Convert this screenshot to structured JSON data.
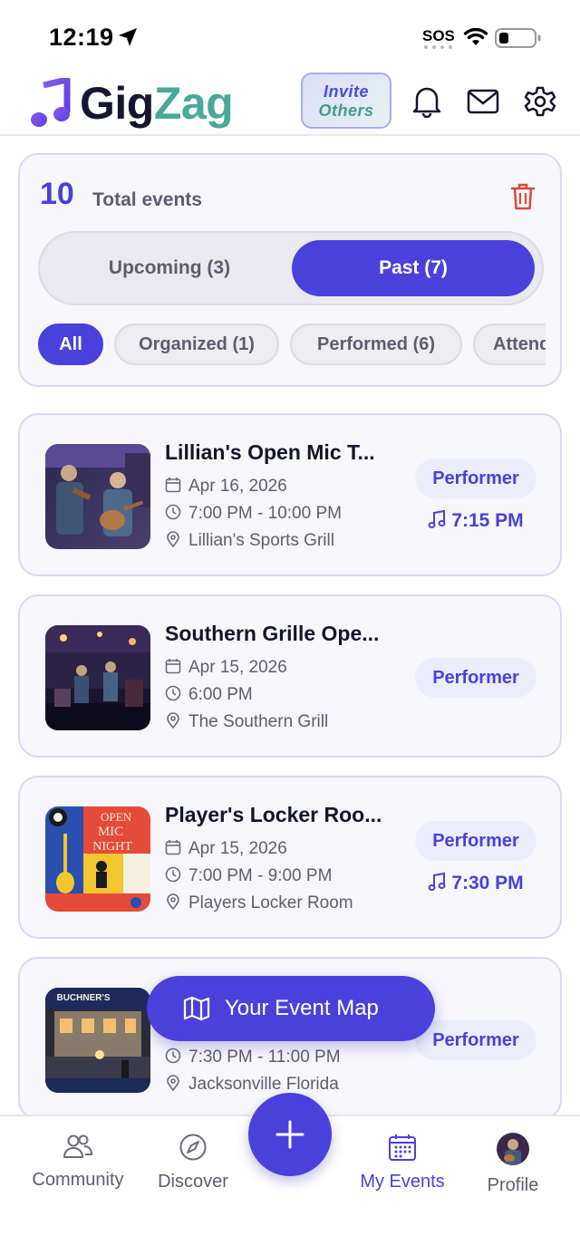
{
  "status_bar": {
    "time": "12:19",
    "sos": "SOS"
  },
  "header": {
    "logo_part1": "Gig",
    "logo_part2": "Zag",
    "invite_line1": "Invite",
    "invite_line2": "Others",
    "brand_color": "#4a40dc",
    "accent_color": "#4aa99a"
  },
  "summary": {
    "total_count": "10",
    "total_label": "Total events",
    "tabs": {
      "upcoming": "Upcoming (3)",
      "past": "Past (7)",
      "selected": "past"
    },
    "filters": [
      "All",
      "Organized (1)",
      "Performed (6)",
      "Attended"
    ],
    "active_filter": "All"
  },
  "events": [
    {
      "title": "Lillian's Open Mic T...",
      "date": "Apr 16, 2026",
      "time": "7:00 PM - 10:00 PM",
      "venue": "Lillian's Sports Grill",
      "role": "Performer",
      "perf_time": "7:15 PM"
    },
    {
      "title": "Southern Grille Ope...",
      "date": "Apr 15, 2026",
      "time": "6:00 PM",
      "venue": "The Southern Grill",
      "role": "Performer",
      "perf_time": ""
    },
    {
      "title": "Player's Locker Roo...",
      "date": "Apr 15, 2026",
      "time": "7:00 PM - 9:00 PM",
      "venue": "Players Locker Room",
      "role": "Performer",
      "perf_time": "7:30 PM"
    },
    {
      "title": "",
      "date": "",
      "time": "7:30 PM - 11:00 PM",
      "venue": "Jacksonville Florida",
      "role": "Performer",
      "perf_time": ""
    }
  ],
  "poster_text": {
    "locker_line1": "OPEN",
    "locker_line2": "MIC",
    "locker_line3": "NIGHT",
    "buchner_line1": "BUCHNER'S"
  },
  "map_button": "Your Event Map",
  "tab_bar": {
    "items": [
      "Community",
      "Discover",
      "My Events",
      "Profile"
    ],
    "active": "My Events"
  }
}
